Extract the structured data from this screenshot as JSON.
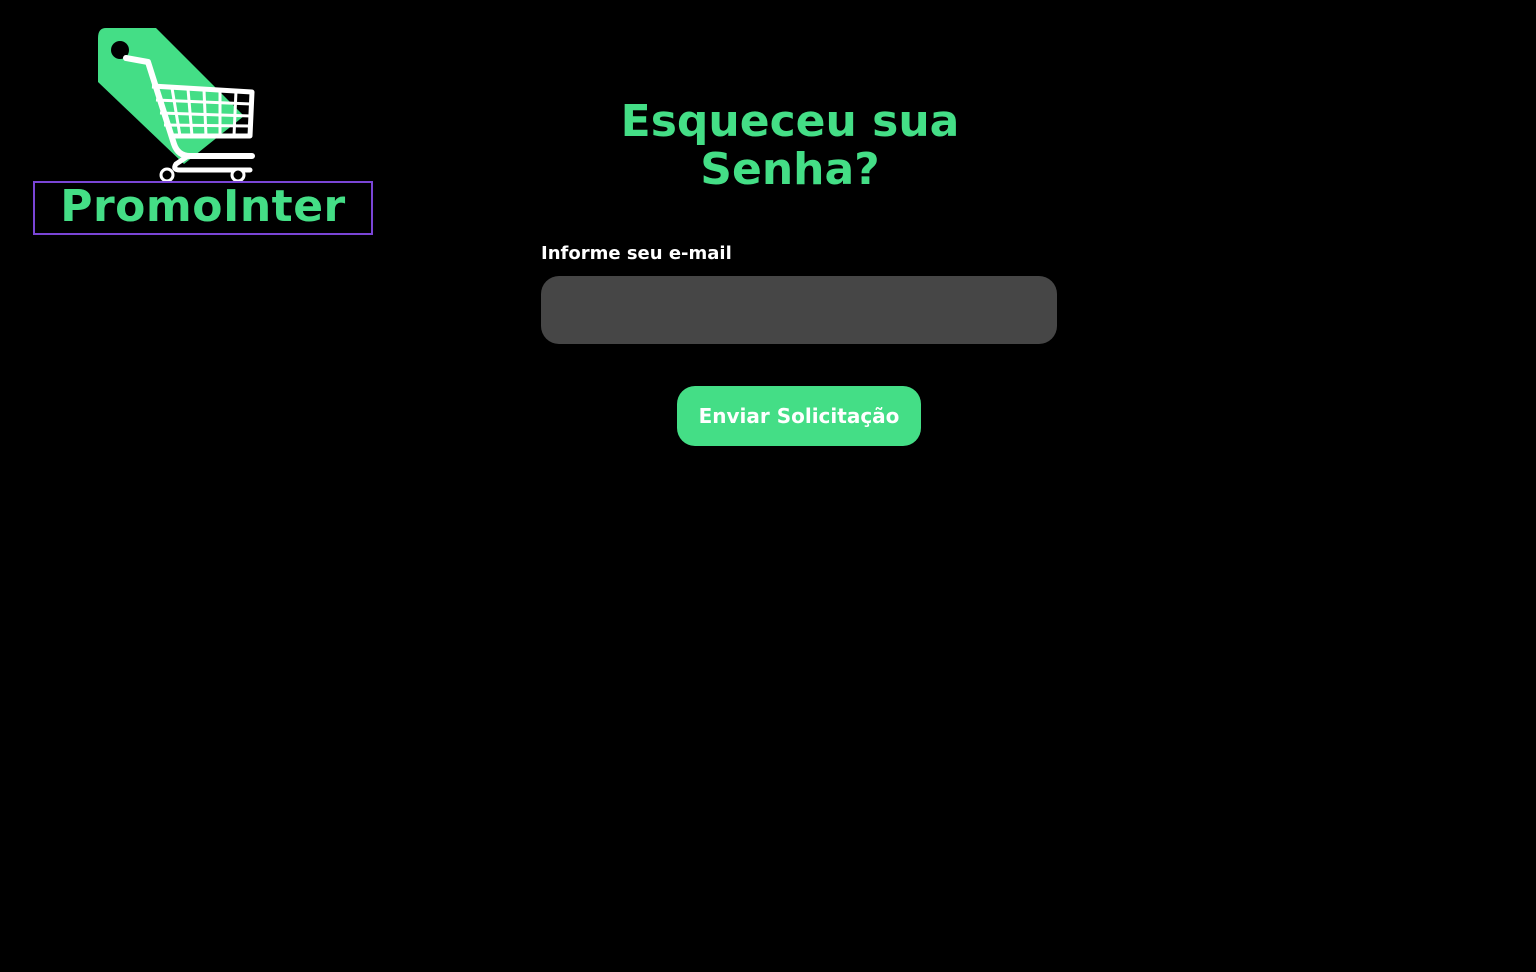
{
  "brand": {
    "name": "PromoInter",
    "logo_icon": "shopping-cart-tag-icon",
    "accent_color": "#44de86",
    "box_border_color": "#7a45d6"
  },
  "main": {
    "title": "Esqueceu sua Senha?",
    "email_label": "Informe seu e-mail",
    "email_value": "",
    "email_placeholder": "",
    "submit_label": "Enviar Solicitação"
  },
  "colors": {
    "background": "#000000",
    "input_background": "#464646",
    "label_text": "#ffffff"
  }
}
